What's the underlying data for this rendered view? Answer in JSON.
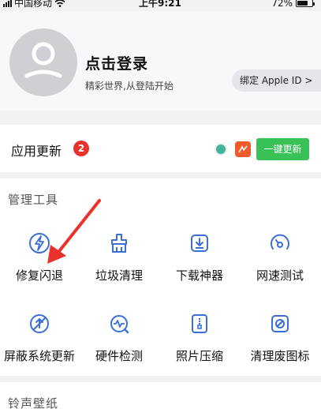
{
  "status_bar": {
    "carrier": "中国移动",
    "time": "上午9:21",
    "battery": "72%",
    "battery_level": 0.72
  },
  "profile": {
    "title": "点击登录",
    "subtitle": "精彩世界,从登陆开始",
    "bind_button": "绑定 Apple ID >"
  },
  "app_update": {
    "title": "应用更新",
    "badge": "2",
    "update_all": "一键更新"
  },
  "tools": {
    "section_title": "管理工具",
    "items": [
      {
        "label": "修复闪退",
        "icon": "lightning-icon"
      },
      {
        "label": "垃圾清理",
        "icon": "broom-icon"
      },
      {
        "label": "下载神器",
        "icon": "download-icon"
      },
      {
        "label": "网速测试",
        "icon": "speedometer-icon"
      },
      {
        "label": "屏蔽系统更新",
        "icon": "block-update-icon"
      },
      {
        "label": "硬件检测",
        "icon": "hardware-check-icon"
      },
      {
        "label": "照片压缩",
        "icon": "photo-compress-icon"
      },
      {
        "label": "清理废图标",
        "icon": "clean-icons-icon"
      }
    ]
  },
  "ringtone": {
    "section_title": "铃声壁纸"
  },
  "colors": {
    "accent_blue": "#3a6fd8",
    "update_green": "#39c157",
    "badge_red": "#e8322b",
    "annotation_red": "#e8322b"
  }
}
